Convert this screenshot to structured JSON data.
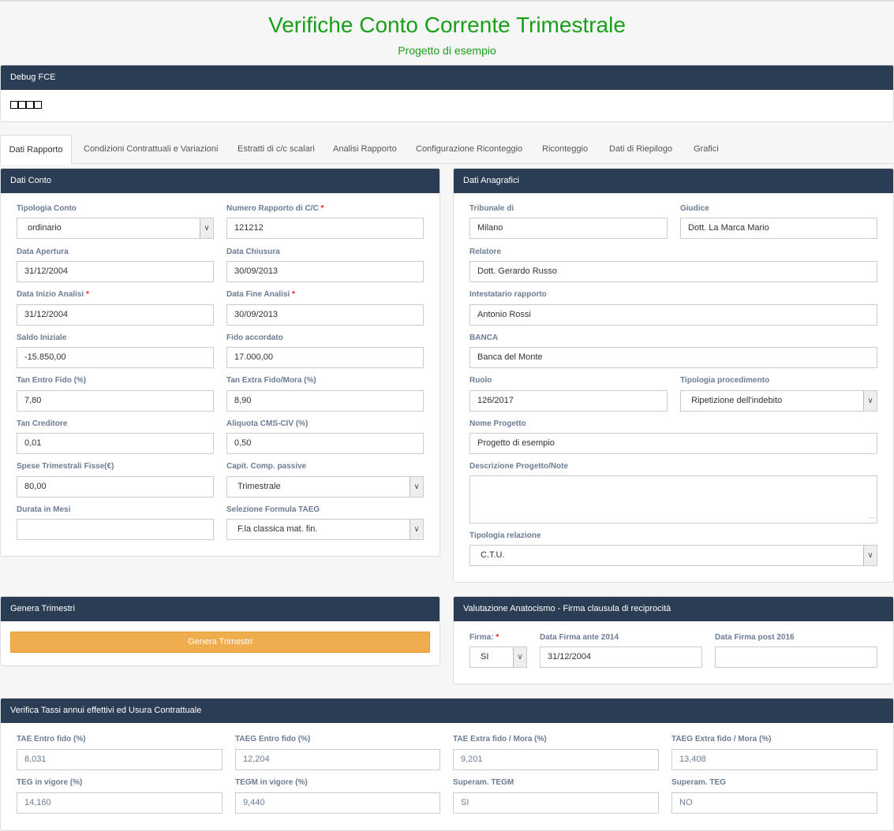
{
  "header": {
    "title": "Verifiche Conto Corrente Trimestrale",
    "subtitle": "Progetto di esempio"
  },
  "debug": {
    "title": "Debug FCE"
  },
  "tabs": [
    {
      "label": "Dati Rapporto"
    },
    {
      "label": "Condizioni Contrattuali e Variazioni"
    },
    {
      "label": "Estratti di c/c scalari"
    },
    {
      "label": "Analisi Rapporto"
    },
    {
      "label": "Configurazione Riconteggio"
    },
    {
      "label": "Riconteggio"
    },
    {
      "label": "Dati di Riepilogo"
    },
    {
      "label": "Grafici"
    }
  ],
  "dati_conto": {
    "title": "Dati Conto",
    "tipologia_conto": {
      "label": "Tipologia Conto",
      "value": "ordinario"
    },
    "numero_rapporto": {
      "label": "Numero Rapporto di C/C",
      "value": "121212"
    },
    "data_apertura": {
      "label": "Data Apertura",
      "value": "31/12/2004"
    },
    "data_chiusura": {
      "label": "Data Chiusura",
      "value": "30/09/2013"
    },
    "data_inizio": {
      "label": "Data Inizio Analisi",
      "value": "31/12/2004"
    },
    "data_fine": {
      "label": "Data Fine Analisi",
      "value": "30/09/2013"
    },
    "saldo_iniziale": {
      "label": "Saldo Iniziale",
      "value": "-15.850,00"
    },
    "fido_accordato": {
      "label": "Fido accordato",
      "value": "17.000,00"
    },
    "tan_entro": {
      "label": "Tan Entro Fido (%)",
      "value": "7,80"
    },
    "tan_extra": {
      "label": "Tan Extra Fido/Mora (%)",
      "value": "8,90"
    },
    "tan_creditore": {
      "label": "Tan Creditore",
      "value": "0,01"
    },
    "aliquota": {
      "label": "Aliquota CMS-CIV (%)",
      "value": "0,50"
    },
    "spese": {
      "label": "Spese Trimestrali Fisse(€)",
      "value": "80,00"
    },
    "capit": {
      "label": "Capit. Comp. passive",
      "value": "Trimestrale"
    },
    "durata": {
      "label": "Durata in Mesi",
      "value": ""
    },
    "formula": {
      "label": "Selezione Formula TAEG",
      "value": "F.la classica mat. fin."
    }
  },
  "dati_anagrafici": {
    "title": "Dati Anagrafici",
    "tribunale": {
      "label": "Tribunale di",
      "value": "Milano"
    },
    "giudice": {
      "label": "Giudice",
      "value": "Dott. La Marca Mario"
    },
    "relatore": {
      "label": "Relatore",
      "value": "Dott. Gerardo Russo"
    },
    "intestatario": {
      "label": "Intestatario rapporto",
      "value": "Antonio Rossi"
    },
    "banca": {
      "label": "BANCA",
      "value": "Banca del Monte"
    },
    "ruolo": {
      "label": "Ruolo",
      "value": "126/2017"
    },
    "procedimento": {
      "label": "Tipologia procedimento",
      "value": "Ripetizione dell'indebito"
    },
    "nome_progetto": {
      "label": "Nome Progetto",
      "value": "Progetto di esempio"
    },
    "descrizione": {
      "label": "Descrizione Progetto/Note",
      "value": ""
    },
    "relazione": {
      "label": "Tipologia relazione",
      "value": "C.T.U."
    }
  },
  "genera": {
    "title": "Genera Trimestri",
    "button": "Genera Trimestri"
  },
  "anatocismo": {
    "title": "Valutazione Anatocismo - Firma clausula di reciprocità",
    "firma": {
      "label": "Firma:",
      "value": "SI"
    },
    "ante": {
      "label": "Data Firma ante 2014",
      "value": "31/12/2004"
    },
    "post": {
      "label": "Data Firma post 2016",
      "value": ""
    }
  },
  "verifica": {
    "title": "Verifica Tassi annui effettivi ed Usura Contrattuale",
    "fields": [
      {
        "label": "TAE Entro fido (%)",
        "value": "8,031"
      },
      {
        "label": "TAEG Entro fido (%)",
        "value": "12,204"
      },
      {
        "label": "TAE Extra fido / Mora (%)",
        "value": "9,201"
      },
      {
        "label": "TAEG Extra fido / Mora (%)",
        "value": "13,408"
      },
      {
        "label": "TEG in vigore (%)",
        "value": "14,160"
      },
      {
        "label": "TEGM in vigore (%)",
        "value": "9,440"
      },
      {
        "label": "Superam. TEGM",
        "value": "SI"
      },
      {
        "label": "Superam. TEG",
        "value": "NO"
      }
    ]
  },
  "colors": {
    "title_green": "#18a018",
    "panel_header": "#2b3d55",
    "label": "#6b7c95",
    "button_orange": "#f0ad4e",
    "required": "#e02020"
  }
}
